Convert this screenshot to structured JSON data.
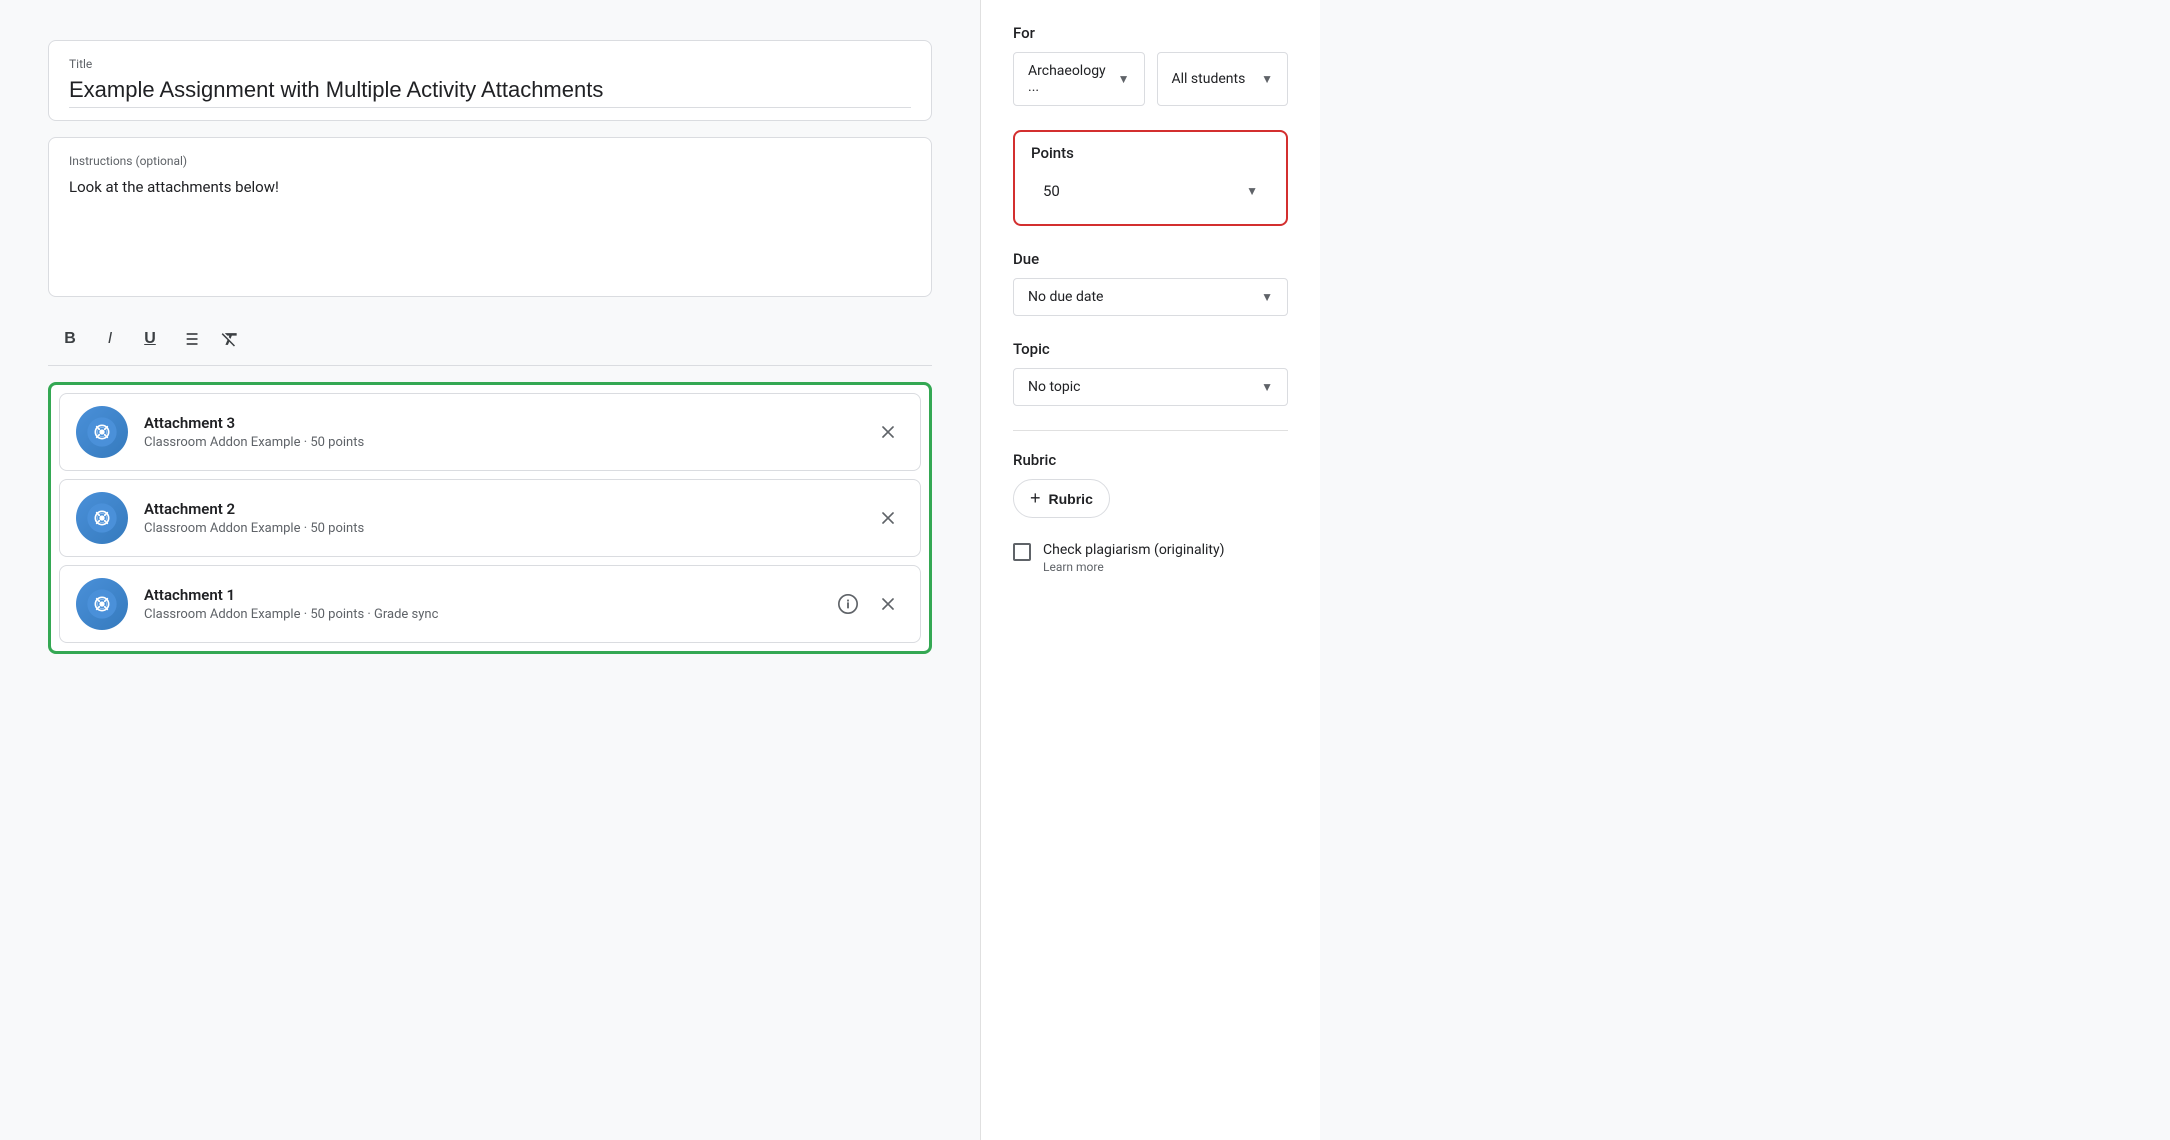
{
  "title": {
    "label": "Title",
    "value": "Example Assignment with Multiple Activity Attachments"
  },
  "instructions": {
    "label": "Instructions (optional)",
    "value": "Look at the attachments below!"
  },
  "toolbar": {
    "bold": "B",
    "italic": "I",
    "underline": "U",
    "list": "≡",
    "clear": "✕"
  },
  "attachments": [
    {
      "id": 3,
      "title": "Attachment 3",
      "subtitle": "Classroom Addon Example • 50 points",
      "hasInfo": false
    },
    {
      "id": 2,
      "title": "Attachment 2",
      "subtitle": "Classroom Addon Example • 50 points",
      "hasInfo": false
    },
    {
      "id": 1,
      "title": "Attachment 1",
      "subtitle": "Classroom Addon Example • 50 points • Grade sync",
      "hasInfo": true
    }
  ],
  "panel": {
    "for_label": "For",
    "class_value": "Archaeology ...",
    "students_value": "All students",
    "points_label": "Points",
    "points_value": "50",
    "due_label": "Due",
    "due_value": "No due date",
    "topic_label": "Topic",
    "topic_value": "No topic",
    "rubric_label": "Rubric",
    "rubric_btn_label": "Rubric",
    "plagiarism_label": "Check plagiarism (originality)",
    "learn_more": "Learn more"
  }
}
